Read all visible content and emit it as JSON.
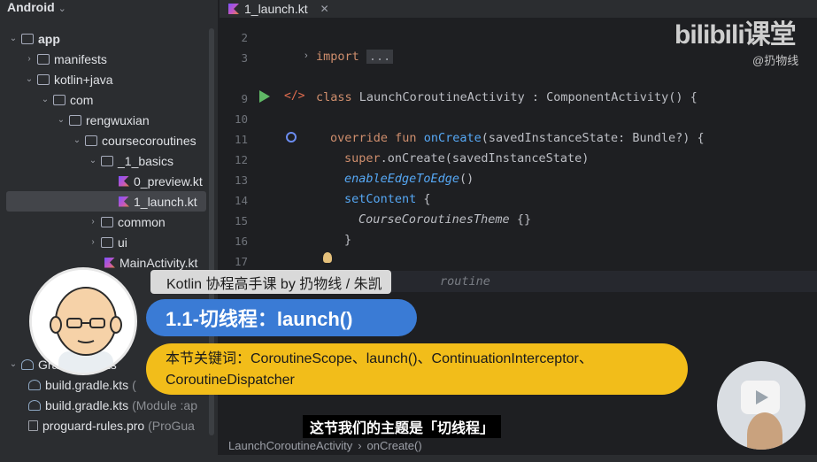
{
  "project": {
    "header": "Android",
    "tree": [
      {
        "label": "app",
        "icon": "module-folder-icon"
      },
      {
        "label": "manifests",
        "icon": "folder-icon"
      },
      {
        "label": "kotlin+java",
        "icon": "folder-icon"
      },
      {
        "label": "com",
        "icon": "package-icon"
      },
      {
        "label": "rengwuxian",
        "icon": "package-icon"
      },
      {
        "label": "coursecoroutines",
        "icon": "package-icon"
      },
      {
        "label": "_1_basics",
        "icon": "package-icon"
      },
      {
        "label": "0_preview.kt",
        "icon": "kotlin-file-icon"
      },
      {
        "label": "1_launch.kt",
        "icon": "kotlin-file-icon"
      },
      {
        "label": "common",
        "icon": "package-icon"
      },
      {
        "label": "ui",
        "icon": "package-icon"
      },
      {
        "label": "MainActivity.kt",
        "icon": "kotlin-file-icon"
      },
      {
        "label": "Gradle Scripts",
        "icon": "gradle-icon"
      },
      {
        "label": "build.gradle.kts",
        "suffix": "(",
        "icon": "gradle-icon"
      },
      {
        "label": "build.gradle.kts",
        "suffix": "(Module :ap",
        "icon": "gradle-icon"
      },
      {
        "label": "proguard-rules.pro",
        "suffix": "(ProGua",
        "icon": "file-icon"
      }
    ]
  },
  "editor": {
    "tab_label": "1_launch.kt",
    "lines": [
      "2",
      "3",
      "9",
      "10",
      "11",
      "12",
      "13",
      "14",
      "15",
      "16",
      "17"
    ],
    "code": {
      "import_kw": "import",
      "import_fold": "...",
      "class_kw": "class",
      "class_decl": "LaunchCoroutineActivity : ComponentActivity() {",
      "override_kw": "override fun",
      "fn_name": "onCreate",
      "fn_params": "(savedInstanceState: Bundle?) {",
      "super_kw": "super",
      "super_call": ".onCreate(savedInstanceState)",
      "edge_fn": "enableEdgeToEdge",
      "edge_call": "()",
      "set_content": "setContent",
      "brace_open": " {",
      "theme": "CourseCoroutinesTheme",
      "theme_body": " {}",
      "brace_close": "}",
      "partial": "routine"
    },
    "breadcrumb": [
      "LaunchCoroutineActivity",
      "onCreate()"
    ]
  },
  "overlay": {
    "brand": "bilibili课堂",
    "handle": "@扔物线",
    "course": "Kotlin 协程高手课   by 扔物线 / 朱凯",
    "title": "1.1-切线程：launch()",
    "keywords_line1": "本节关键词：CoroutineScope、launch()、ContinuationInterceptor、",
    "keywords_line2": "CoroutineDispatcher",
    "subtitle": "这节我们的主题是「切线程」"
  }
}
